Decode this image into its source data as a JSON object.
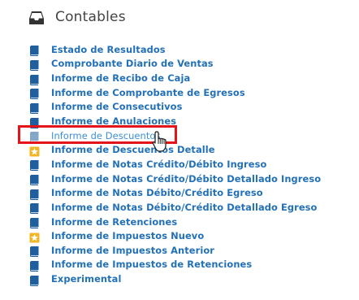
{
  "section": {
    "title": "Contables",
    "icon": "inbox-icon"
  },
  "colors": {
    "link": "#2270b8",
    "book_icon": "#1f5f9e",
    "star_icon": "#f2b624",
    "highlight": "#e3151a",
    "title": "#444444"
  },
  "reports": [
    {
      "label": "Estado de Resultados",
      "icon": "book-icon"
    },
    {
      "label": "Comprobante Diario de Ventas",
      "icon": "book-icon"
    },
    {
      "label": "Informe de Recibo de Caja",
      "icon": "book-icon"
    },
    {
      "label": "Informe de Comprobante de Egresos",
      "icon": "book-icon"
    },
    {
      "label": "Informe de Consecutivos",
      "icon": "book-icon"
    },
    {
      "label": "Informe de Anulaciones",
      "icon": "book-icon"
    },
    {
      "label": "Informe de Descuentos",
      "icon": "book-icon",
      "state": "hovered"
    },
    {
      "label": "Informe de Descuentos Detalle",
      "icon": "star-icon"
    },
    {
      "label": "Informe de Notas Crédito/Débito Ingreso",
      "icon": "book-icon"
    },
    {
      "label": "Informe de Notas Crédito/Débito Detallado Ingreso",
      "icon": "book-icon"
    },
    {
      "label": "Informe de Notas Débito/Crédito Egreso",
      "icon": "book-icon"
    },
    {
      "label": "Informe de Notas Débito/Crédito Detallado Egreso",
      "icon": "book-icon"
    },
    {
      "label": "Informe de Retenciones",
      "icon": "book-icon"
    },
    {
      "label": "Informe de Impuestos Nuevo",
      "icon": "star-icon"
    },
    {
      "label": "Informe de Impuestos Anterior",
      "icon": "book-icon"
    },
    {
      "label": "Informe de Impuestos de Retenciones",
      "icon": "book-icon"
    },
    {
      "label": "Experimental",
      "icon": "book-icon"
    }
  ]
}
